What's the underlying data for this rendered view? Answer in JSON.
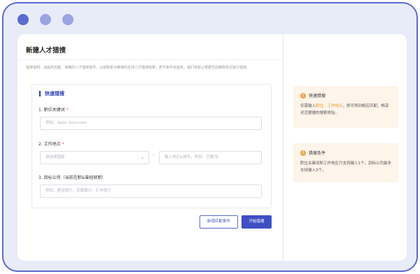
{
  "page": {
    "title": "新建人才猎搜",
    "description": "猎搜说明：请提供完整、准确的人才猎搜条件，以获取更为精准的全球人才猎搜结果。若节条件未提供，我们将默认根据当前推荐情况进行猎搜。"
  },
  "form": {
    "section_title": "快速猎搜",
    "job_keyword": {
      "label": "1. 职位关键词",
      "required_mark": "*",
      "placeholder": "例如：Sales Associate"
    },
    "location": {
      "label": "2. 工作地点",
      "required_mark": "*",
      "select_placeholder": "请选择国家",
      "separator": "-",
      "input_placeholder": "输入地区&城市，例如：巴黎/伦"
    },
    "target_company": {
      "label": "3. 目标公司（当前在职&曾经就职）",
      "placeholder": "例如：建设银行、花旗银行、汇丰银行"
    }
  },
  "buttons": {
    "add_condition": "新增匹配条件",
    "start_search": "开始猎搜"
  },
  "tips": [
    {
      "num": "1",
      "title": "快速猎搜",
      "body_prefix": "仅需输入",
      "highlight": "职位、工作地点",
      "body_suffix": "，即可得到相应匹配，畅享灵活便捷的搜索体验。"
    },
    {
      "num": "2",
      "title": "猎搜条件",
      "body": "职位关键词和工作地区只支持输入1个，目标公司最多支持输入3个。"
    }
  ],
  "icons": {
    "select_arrow": "chevron-down-icon"
  },
  "colors": {
    "accent": "#3e4fc4",
    "frame": "#5b6ad0",
    "tip_bg": "#fdf4ea",
    "tip_badge": "#f0a54d",
    "highlight": "#e8922a"
  }
}
